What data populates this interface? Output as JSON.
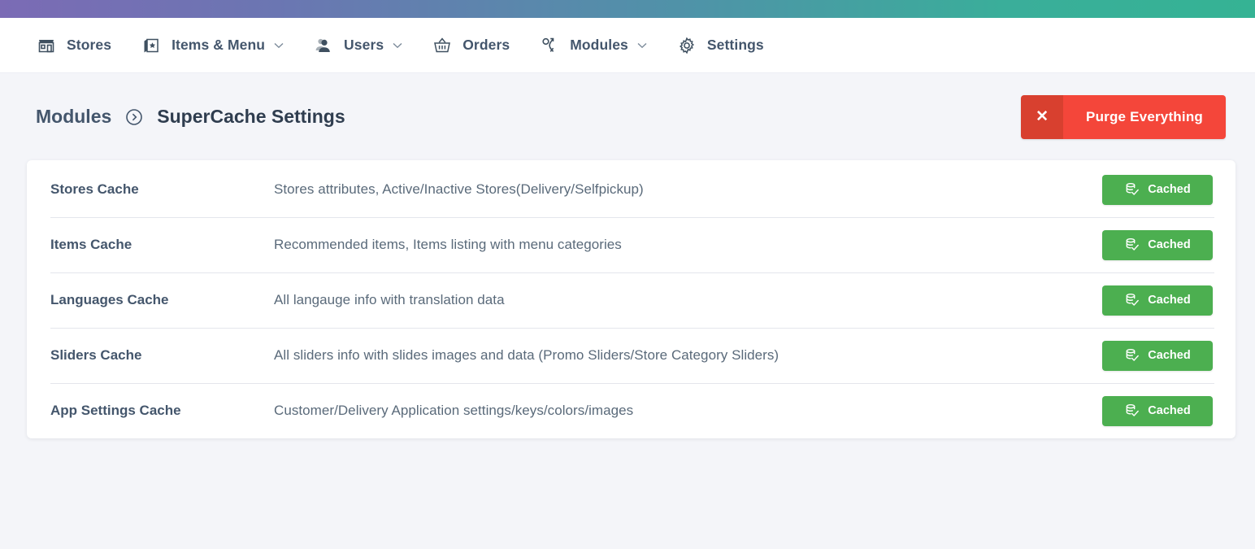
{
  "theme": {
    "gradient_start": "#7b6bb5",
    "gradient_end": "#35b394",
    "page_background": "#f4f5f9",
    "accent_danger": "#f4463a",
    "accent_danger_dark": "#d8402f",
    "accent_success": "#4caf50",
    "text_primary": "#44566c"
  },
  "navbar": {
    "items": [
      {
        "label": "Stores",
        "icon": "storefront-icon",
        "has_caret": false
      },
      {
        "label": "Items & Menu",
        "icon": "cards-star-icon",
        "has_caret": true
      },
      {
        "label": "Users",
        "icon": "users-icon",
        "has_caret": true
      },
      {
        "label": "Orders",
        "icon": "basket-icon",
        "has_caret": false
      },
      {
        "label": "Modules",
        "icon": "modules-icon",
        "has_caret": true
      },
      {
        "label": "Settings",
        "icon": "gear-icon",
        "has_caret": false
      }
    ]
  },
  "page_header": {
    "breadcrumb_root": "Modules",
    "breadcrumb_separator_icon": "circle-chevron-right-icon",
    "breadcrumb_current": "SuperCache Settings",
    "purge_button": {
      "icon": "close-x-icon",
      "icon_glyph": "✕",
      "label": "Purge Everything"
    }
  },
  "cache_list": {
    "rows": [
      {
        "name": "Stores Cache",
        "description": "Stores attributes, Active/Inactive Stores(Delivery/Selfpickup)",
        "status_label": "Cached",
        "status_icon": "database-check-icon"
      },
      {
        "name": "Items Cache",
        "description": "Recommended items, Items listing with menu categories",
        "status_label": "Cached",
        "status_icon": "database-check-icon"
      },
      {
        "name": "Languages Cache",
        "description": "All langauge info with translation data",
        "status_label": "Cached",
        "status_icon": "database-check-icon"
      },
      {
        "name": "Sliders Cache",
        "description": "All sliders info with slides images and data (Promo Sliders/Store Category Sliders)",
        "status_label": "Cached",
        "status_icon": "database-check-icon"
      },
      {
        "name": "App Settings Cache",
        "description": "Customer/Delivery Application settings/keys/colors/images",
        "status_label": "Cached",
        "status_icon": "database-check-icon"
      }
    ]
  }
}
